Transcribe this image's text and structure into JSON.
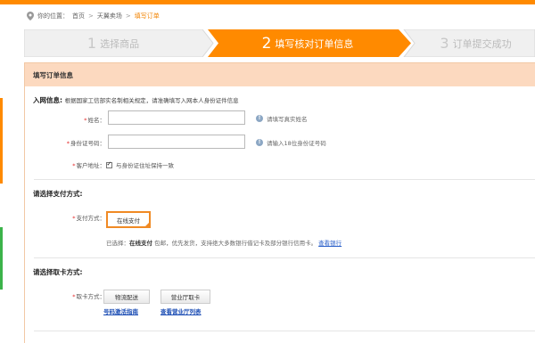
{
  "breadcrumb": {
    "prefix": "你的位置：",
    "items": [
      "首页",
      "天翼卖场",
      "填写订单"
    ],
    "separator": ">"
  },
  "steps": [
    {
      "num": "1",
      "label": "选择商品",
      "state": "done"
    },
    {
      "num": "2",
      "label": "填写核对订单信息",
      "state": "active"
    },
    {
      "num": "3",
      "label": "订单提交成功",
      "state": "pending"
    }
  ],
  "colors": {
    "accent": "#ff8a00",
    "panel_header": "#fcd9bf",
    "link": "#2a5fc9"
  },
  "panel": {
    "title": "填写订单信息"
  },
  "network": {
    "title": "入网信息:",
    "note": "根据国家工信部实名制相关规定，请准确填写入网本人身份证件信息",
    "name_label": "姓名：",
    "name_hint": "请填写真实姓名",
    "id_label": "身份证号码：",
    "id_hint": "请输入18位身份证号码",
    "address_label": "客户地址：",
    "address_check": "与身份证住址保持一致"
  },
  "payment": {
    "title": "请选择支付方式:",
    "label": "支付方式：",
    "option": "在线支付",
    "note_prefix": "已选择：",
    "note_bold": "在线支付",
    "note_rest": "包邮，优先发货，支持绝大多数银行借记卡及部分银行信用卡。",
    "note_link": "查看银行"
  },
  "pickup": {
    "title": "请选择取卡方式:",
    "label": "取卡方式：",
    "options": [
      {
        "label": "物流配送",
        "link": "号码激活指南"
      },
      {
        "label": "营业厅取卡",
        "link": "查看营业厅列表"
      }
    ]
  },
  "icons": {
    "location": "location-pin-icon",
    "info": "info-icon",
    "check": "checkmark-icon"
  }
}
